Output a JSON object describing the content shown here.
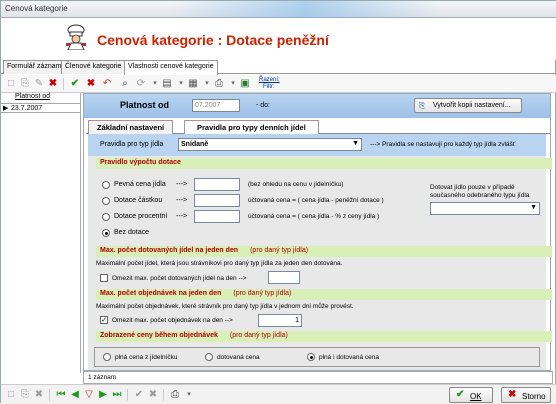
{
  "window": {
    "title": "Cenová kategorie"
  },
  "header": {
    "title": "Cenová kategorie : Dotace peněžní"
  },
  "main_tabs": [
    "Formulář záznamu",
    "Členové kategorie",
    "Vlastnosti cenové kategorie"
  ],
  "toolbar": {
    "sort_label": "Řazení:",
    "filter_label": "Filtr:"
  },
  "left_grid": {
    "column": "Platnost od",
    "rows": [
      "23.7.2007"
    ]
  },
  "platnost": {
    "label": "Platnost od",
    "value": "07.2007",
    "do_label": "- do:",
    "copy_button": "Vytvořit kopii nastavení..."
  },
  "sub_tabs": [
    "Základní nastavení",
    "Pravidla pro typy denních jídel"
  ],
  "rule": {
    "label": "Pravidla pro typ jídla",
    "value": "Snídaně",
    "note": "---> Pravidla se nastavují pro každý typ jídla zvlášť"
  },
  "section1": {
    "title": "Pravidlo výpočtu dotace",
    "options": [
      {
        "label": "Pevná cena jídla",
        "arrow": "--->",
        "note": "(bez ohledu na cenu v jídelníčku)"
      },
      {
        "label": "Dotace částkou",
        "arrow": "--->",
        "note": "účtovaná cena = ( cena jídla - peněžní dotace )"
      },
      {
        "label": "Dotace procentní",
        "arrow": "--->",
        "note": "účtovaná cena = ( cena jídla - % z ceny jídla )"
      },
      {
        "label": "Bez dotace"
      }
    ],
    "dotovat_label_1": "Dotovat jídlo pouze v případě",
    "dotovat_label_2": "současného odebraného typu jídla"
  },
  "section2": {
    "title": "Max. počet dotovaných jídel na jeden den",
    "note": "(pro daný typ jídla)",
    "desc": "Maximální počet jídel, která jsou strávníkovi pro daný typ jídla za jeden den dotována.",
    "check_label": "Omezit max. počet dotovaných jídel na den -->",
    "value": ""
  },
  "section3": {
    "title": "Max. počet objednávek na jeden den",
    "note": "(pro daný typ jídla)",
    "desc": "Maximální počet objednávek, které strávník pro daný typ jídla v jednom dni může provést.",
    "check_label": "Omezit max. počet objednávek na den -->",
    "value": "1"
  },
  "section4": {
    "title": "Zobrazené ceny během objednávek",
    "note": "(pro daný typ jídla)",
    "options": [
      "plná cena z jídelníčku",
      "dotovaná cena",
      "plná i dotovaná cena"
    ]
  },
  "status": {
    "records": "1 záznam"
  },
  "buttons": {
    "ok": "OK",
    "cancel": "Storno"
  },
  "colors": {
    "title_red": "#cc2200",
    "section_green": "#d9efb8",
    "platnost_blue": "#9cc0e8"
  }
}
